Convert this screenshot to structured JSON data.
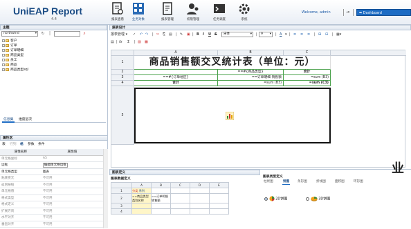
{
  "header": {
    "logo": "UniEAP Report",
    "version": "4.4",
    "nav": [
      {
        "label": "报表查看",
        "icon": "report-view-icon"
      },
      {
        "label": "业务对象",
        "icon": "business-object-icon"
      },
      {
        "label": "报表管理",
        "icon": "report-manage-icon"
      },
      {
        "label": "权限管理",
        "icon": "permission-icon"
      },
      {
        "label": "任务调度",
        "icon": "schedule-icon"
      },
      {
        "label": "系统",
        "icon": "system-gear-icon"
      }
    ],
    "welcome": "Welcome, admin",
    "dashboard": "Dashboard"
  },
  "left": {
    "title": "主题",
    "datasource": "northwind",
    "tree": [
      "客户",
      "订单",
      "订单明细",
      "商品类型",
      "员工",
      "商品",
      "商品类型sql"
    ],
    "tabs": [
      "信息集",
      "维度层次"
    ],
    "props_title": "属性区",
    "prop_tabs": [
      "表",
      "行列",
      "格",
      "参数",
      "条件"
    ],
    "prop_headers": [
      "属性名称",
      "属性值"
    ],
    "props": [
      {
        "name": "单元格坐标",
        "value": "A5"
      },
      {
        "name": "边框",
        "value": "编辑单元格边框"
      },
      {
        "name": "单元格类型",
        "value": "图表"
      },
      {
        "name": "贴底变元",
        "value": "不可用"
      },
      {
        "name": "返回按钮",
        "value": "不可用"
      },
      {
        "name": "单元格值",
        "value": "不可用"
      },
      {
        "name": "格式类型",
        "value": "不可用"
      },
      {
        "name": "格式定义",
        "value": "不可用"
      },
      {
        "name": "扩展方向",
        "value": "不可用"
      },
      {
        "name": "水平对齐",
        "value": "不可用"
      },
      {
        "name": "垂直对齐",
        "value": "不可用"
      }
    ]
  },
  "main": {
    "title": "报表设计",
    "toolbar_label": "报表管理",
    "font": "宋体",
    "size": "9",
    "fx": "fx",
    "columns": [
      "A",
      "B",
      "C"
    ],
    "rows": [
      "1",
      "2",
      "3",
      "4",
      "5"
    ],
    "cells": {
      "title": "商品销售额交叉统计表（单位：元）",
      "r2b": "==#{商品类型}",
      "r2c": "合计",
      "r3a": "==#{订单地区}",
      "r3b": "==订单明细 销售额",
      "r3c": "=sum (B3)",
      "r4a": "合计",
      "r4b": "=sum (B3)",
      "r4c": "=sum (C3)"
    }
  },
  "bottom": {
    "title": "图表定义",
    "left_title": "图表数据定义",
    "mini_cols": [
      "A",
      "B",
      "C",
      "D",
      "E"
    ],
    "mini_rows": [
      "1",
      "2",
      "3",
      "4"
    ],
    "mini_r1a": "分类",
    "mini_r1b": "系列",
    "mini_r2a": "==商品类型 类别名称",
    "mini_r2b": "==订单明细 销售额",
    "right_title": "图表类型定义",
    "chart_tabs": [
      "柱状图",
      "饼图",
      "条形图",
      "折线图",
      "面积图",
      "环形图"
    ],
    "opt1": "2D饼图",
    "opt2": "3D饼图",
    "big": "业"
  },
  "colors": {
    "brand": "#1d4e86",
    "accent": "#1d6cc4",
    "title_bg": "#ffffff",
    "green_line": "#49a14a"
  }
}
